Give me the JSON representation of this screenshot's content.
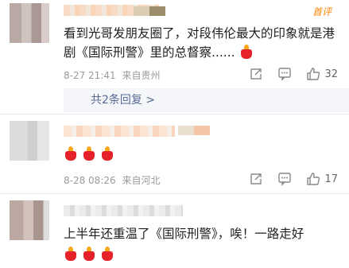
{
  "comments": [
    {
      "text": "看到光哥发朋友圈了，对段伟伦最大的印象就是港剧《国际刑警》里的总督察......",
      "emoji_count": 1,
      "date": "8-27 21:41",
      "location": "来自贵州",
      "likes": "32",
      "badge": "首评",
      "replies_label": "共2条回复 >"
    },
    {
      "text": "",
      "emoji_count": 3,
      "date": "8-28 08:26",
      "location": "来自河北",
      "likes": "17"
    },
    {
      "text": "上半年还重温了《国际刑警》，唉！一路走好",
      "emoji_count": 3
    }
  ],
  "colors": {
    "link": "#576b95",
    "badge": "#ff8200",
    "candle": "#e5212a",
    "flame": "#f9a61a"
  },
  "icons": [
    "share-icon",
    "comment-icon",
    "like-icon",
    "candle-emoji"
  ]
}
